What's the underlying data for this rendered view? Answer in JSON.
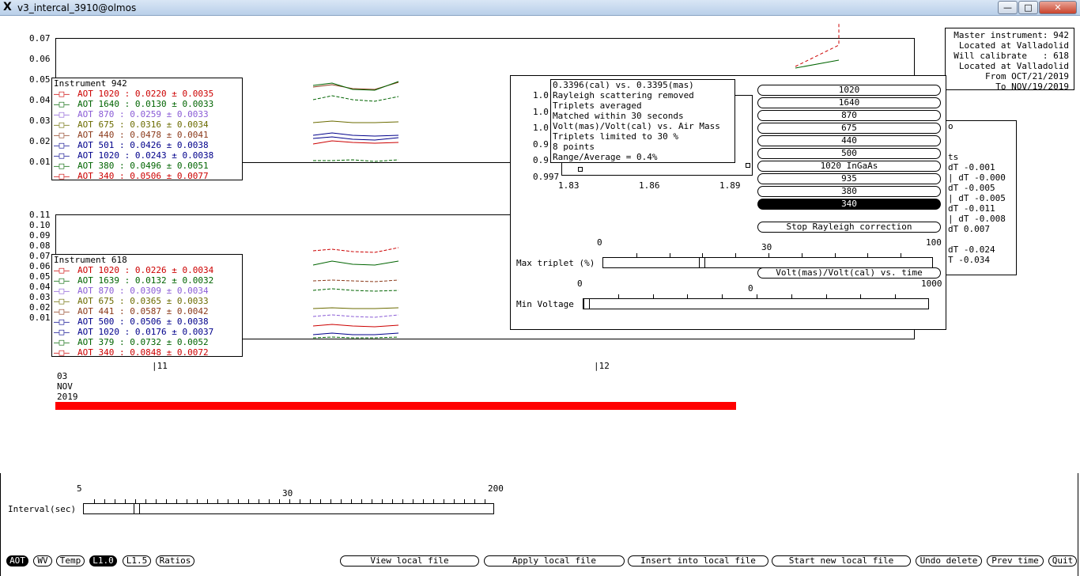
{
  "window": {
    "title": "v3_intercal_3910@olmos",
    "app_icon": "X",
    "minimize_icon": "minimize-icon",
    "maximize_icon": "maximize-icon",
    "close_icon": "close-icon"
  },
  "colors": {
    "red": "#cc0000",
    "green": "#006400",
    "violet": "#8a5cd6",
    "olive": "#6b6b00",
    "brown": "#8b3a1a",
    "blue": "#00008b",
    "progress": "#ff0000"
  },
  "top_plot": {
    "y_ticks": [
      "0.07",
      "0.06",
      "0.05",
      "0.04",
      "0.03",
      "0.02",
      "0.01"
    ]
  },
  "bottom_plot": {
    "y_ticks": [
      "0.11",
      "0.10",
      "0.09",
      "0.08",
      "0.07",
      "0.06",
      "0.05",
      "0.04",
      "0.03",
      "0.02",
      "0.01"
    ]
  },
  "legend942": {
    "title": "Instrument 942",
    "rows": [
      {
        "label": "AOT 1020 :",
        "value": " 0.0220 ± 0.0035",
        "color": "#cc0000"
      },
      {
        "label": "AOT 1640 :",
        "value": " 0.0130 ± 0.0033",
        "color": "#006400"
      },
      {
        "label": "AOT 870 :",
        "value": " 0.0259 ± 0.0033",
        "color": "#8a5cd6"
      },
      {
        "label": "AOT 675 :",
        "value": " 0.0316 ± 0.0034",
        "color": "#6b6b00"
      },
      {
        "label": "AOT 440 :",
        "value": " 0.0478 ± 0.0041",
        "color": "#8b3a1a"
      },
      {
        "label": "AOT 501 :",
        "value": " 0.0426 ± 0.0038",
        "color": "#00008b"
      },
      {
        "label": "AOT 1020 :",
        "value": " 0.0243 ± 0.0038",
        "color": "#00008b"
      },
      {
        "label": "AOT 380 :",
        "value": " 0.0496 ± 0.0051",
        "color": "#006400"
      },
      {
        "label": "AOT 340 :",
        "value": " 0.0506 ± 0.0077",
        "color": "#cc0000"
      }
    ]
  },
  "legend618": {
    "title": "Instrument 618",
    "rows": [
      {
        "label": "AOT 1020 :",
        "value": " 0.0226 ± 0.0034",
        "color": "#cc0000"
      },
      {
        "label": "AOT 1639 :",
        "value": " 0.0132 ± 0.0032",
        "color": "#006400"
      },
      {
        "label": "AOT 870 :",
        "value": " 0.0309 ± 0.0034",
        "color": "#8a5cd6"
      },
      {
        "label": "AOT 675 :",
        "value": " 0.0365 ± 0.0033",
        "color": "#6b6b00"
      },
      {
        "label": "AOT 441 :",
        "value": " 0.0587 ± 0.0042",
        "color": "#8b3a1a"
      },
      {
        "label": "AOT 500 :",
        "value": " 0.0506 ± 0.0038",
        "color": "#00008b"
      },
      {
        "label": "AOT 1020 :",
        "value": " 0.0176 ± 0.0037",
        "color": "#00008b"
      },
      {
        "label": "AOT 379 :",
        "value": " 0.0732 ± 0.0052",
        "color": "#006400"
      },
      {
        "label": "AOT 340 :",
        "value": " 0.0848 ± 0.0072",
        "color": "#cc0000"
      }
    ]
  },
  "x_axis": {
    "tick1": "|11",
    "tick2": "|12",
    "date_day": "03",
    "date_month": "NOV",
    "date_year": "2019"
  },
  "progress": {
    "fraction": 0.63
  },
  "master_info": {
    "lines": [
      "Master instrument: 942",
      " Located at Valladolid",
      "Will calibrate   : 618",
      " Located at Valladolid",
      "From OCT/21/2019",
      "To NOV/19/2019"
    ]
  },
  "right_partial": {
    "lines": [
      "o",
      "",
      "",
      "ts",
      "dT -0.001",
      "| dT -0.000",
      "dT -0.005",
      "| dT -0.005",
      "dT -0.011",
      "| dT -0.008",
      "dT 0.007",
      "",
      "dT -0.024",
      "T -0.034"
    ]
  },
  "popup": {
    "info_lines": [
      "0.3396(cal) vs. 0.3395(mas)",
      "Rayleigh scattering removed",
      "Triplets averaged",
      "Matched within 30 seconds",
      "Volt(mas)/Volt(cal) vs. Air Mass",
      "Triplets limited to 30 %",
      "8 points",
      "Range/Average = 0.4%"
    ],
    "mini_y_ticks": [
      "1.0",
      "1.0",
      "1.0",
      "0.9",
      "0.9",
      "0.997"
    ],
    "mini_x_ticks": [
      "1.83",
      "1.86",
      "1.89"
    ],
    "wavelength_buttons": [
      "1020",
      "1640",
      "870",
      "675",
      "440",
      "500",
      "1020 InGaAs",
      "935",
      "380",
      "340"
    ],
    "selected_wavelength": "340",
    "stop_rayleigh": "Stop Rayleigh correction",
    "volt_time": "Volt(mas)/Volt(cal) vs. time",
    "max_triplet": {
      "label": "Max triplet (%)",
      "min": "0",
      "max": "100",
      "mid": "30",
      "value": 30
    },
    "min_voltage": {
      "label": "Min Voltage",
      "min": "0",
      "max": "1000",
      "mid": "0",
      "value": 0
    }
  },
  "interval": {
    "label": "Interval(sec)",
    "min": "5",
    "mid": "30",
    "max": "200",
    "value": 30
  },
  "bottom_buttons": {
    "aot": "AOT",
    "wv": "WV",
    "temp": "Temp",
    "l10": "L1.0",
    "l15": "L1.5",
    "ratios": "Ratios",
    "view_local": "View local file",
    "apply_local": "Apply local file",
    "insert_local": "Insert into local file",
    "start_new": "Start new local file",
    "undo_delete": "Undo delete",
    "prev_time": "Prev time",
    "quit": "Quit"
  }
}
